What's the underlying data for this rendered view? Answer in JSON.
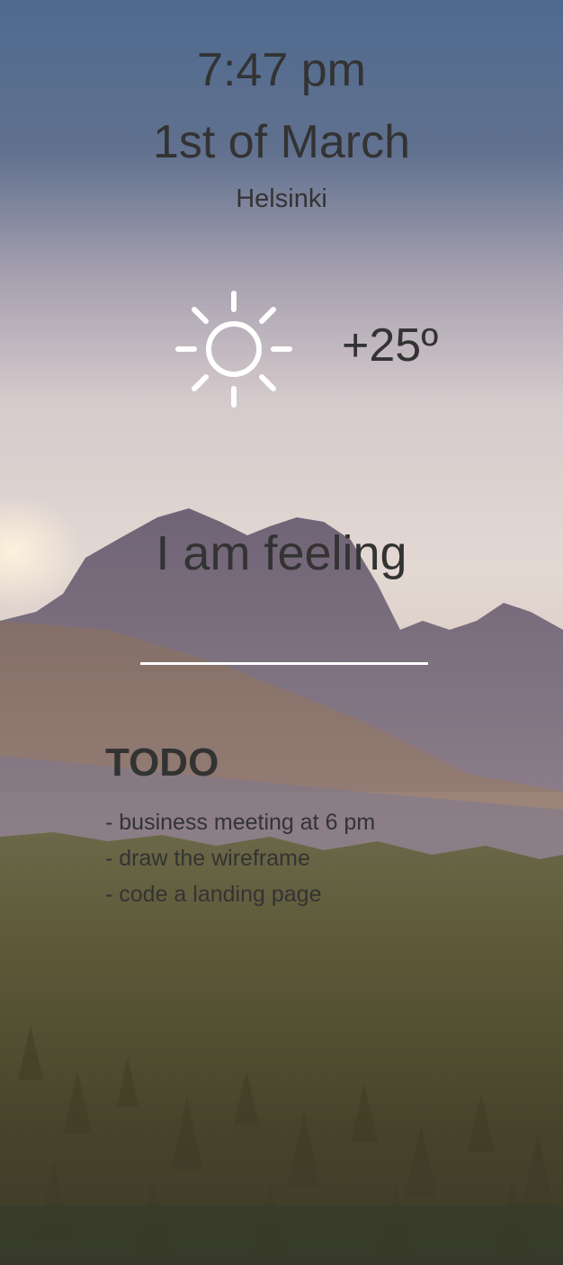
{
  "clock": {
    "time": "7:47 pm",
    "date": "1st of March",
    "city": "Helsinki"
  },
  "weather": {
    "icon": "sun-icon",
    "temperature": "+25º"
  },
  "mood": {
    "label": "I am feeling",
    "value": ""
  },
  "todo": {
    "title": "TODO",
    "items": [
      "- business meeting at 6 pm",
      "- draw the wireframe",
      "- code a landing page"
    ]
  },
  "colors": {
    "text": "#333333",
    "input_underline": "#ffffff",
    "sky_top": "#4f6a8f",
    "sky_mid": "#d8cbcc",
    "forest": "#4a4a2e"
  }
}
